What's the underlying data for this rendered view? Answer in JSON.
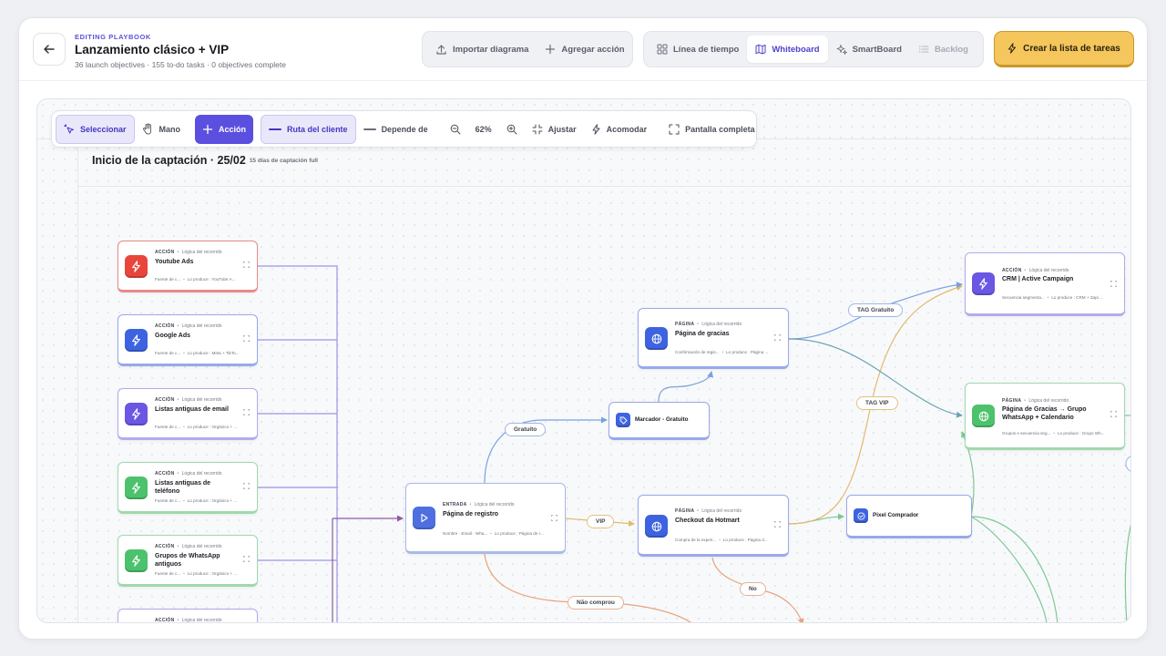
{
  "header": {
    "eyebrow": "EDITING PLAYBOOK",
    "title": "Lanzamiento clásico + VIP",
    "subtitle": "36 launch objectives · 155 to-do tasks · 0 objectives complete",
    "actions": {
      "import": "Importar diagrama",
      "add_action": "Agregar acción"
    },
    "views": {
      "timeline": "Línea de tiempo",
      "whiteboard": "Whiteboard",
      "smartboard": "SmartBoard",
      "backlog": "Backlog"
    },
    "cta": "Crear la lista de tareas"
  },
  "toolbar": {
    "select": "Seleccionar",
    "hand": "Mano",
    "action": "Acción",
    "route": "Ruta del cliente",
    "depends": "Depende de",
    "zoom": "62%",
    "fit": "Ajustar",
    "arrange": "Acomodar",
    "fullscreen": "Pantalla completa"
  },
  "section": {
    "title": "Inicio de la captación · 25/02",
    "subtitle": "15 días de captación full"
  },
  "nodes": {
    "youtube": {
      "kind": "ACCIÓN",
      "logic": "Lógica del recorrido",
      "title": "Youtube Ads",
      "foot_a": "Fuente de c...",
      "foot_b": "Lo produce : YouTube A..."
    },
    "google": {
      "kind": "ACCIÓN",
      "logic": "Lógica del recorrido",
      "title": "Google Ads",
      "foot_a": "Fuente de c...",
      "foot_b": "Lo produce : Meta + TikTo..."
    },
    "email": {
      "kind": "ACCIÓN",
      "logic": "Lógica del recorrido",
      "title": "Listas antiguas de email",
      "foot_a": "Fuente de c...",
      "foot_b": "Lo produce : Orgánico + ..."
    },
    "phone": {
      "kind": "ACCIÓN",
      "logic": "Lógica del recorrido",
      "title": "Listas antiguas de teléfono",
      "foot_a": "Fuente de c...",
      "foot_b": "Lo produce : Orgánico + ..."
    },
    "whatsapp": {
      "kind": "ACCIÓN",
      "logic": "Lógica del recorrido",
      "title": "Grupos de WhatsApp antiguos",
      "foot_a": "Fuente de c...",
      "foot_b": "Lo produce : Orgánico + ..."
    },
    "extra": {
      "kind": "ACCIÓN",
      "logic": "Lógica del recorrido"
    },
    "registro": {
      "kind": "ENTRADA",
      "logic": "Lógica del recorrido",
      "title": "Página de registro",
      "foot_a": "Nombre · Email · Wha...",
      "foot_b": "Lo produce : Página de r..."
    },
    "gracias": {
      "kind": "PÁGINA",
      "logic": "Lógica del recorrido",
      "title": "Página de gracias",
      "foot_a": "Confirmación de regis...",
      "foot_b": "Lo produce : Página ..."
    },
    "marcador": {
      "title": "Marcador - Gratuito"
    },
    "checkout": {
      "kind": "PÁGINA",
      "logic": "Lógica del recorrido",
      "title": "Checkout da Hotmart",
      "foot_a": "Compra de la experi...",
      "foot_b": "Lo produce : Página d..."
    },
    "pixel": {
      "title": "Pixel Comprador"
    },
    "crm": {
      "kind": "ACCIÓN",
      "logic": "Lógica del recorrido",
      "title": "CRM | Active Campaign",
      "foot_a": "Secuencia segmenta...",
      "foot_b": "Lo produce : CRM + Zapi ..."
    },
    "gracias_grupo": {
      "kind": "PÁGINA",
      "logic": "Lógica del recorrido",
      "title": "Página de Gracias → Grupo WhatsApp + Calendario",
      "foot_a": "Grupos e secuencia seg...",
      "foot_b": "Lo produce : Grupo Wh..."
    }
  },
  "edge_labels": {
    "gratuito": "Gratuito",
    "vip": "VIP",
    "nao_comprou": "Não comprou",
    "no": "No",
    "tag_gratuito": "TAG Gratuito",
    "tag_vip": "TAG VIP"
  },
  "colors": {
    "accent": "#5b4fe0",
    "cta": "#f4c65c",
    "route_purple": "#8c7fe6",
    "route_blue": "#7aa0df",
    "route_orange": "#e9a27a",
    "route_gold": "#e3b96d",
    "route_teal": "#6aa3b5",
    "route_green": "#7cc894"
  }
}
